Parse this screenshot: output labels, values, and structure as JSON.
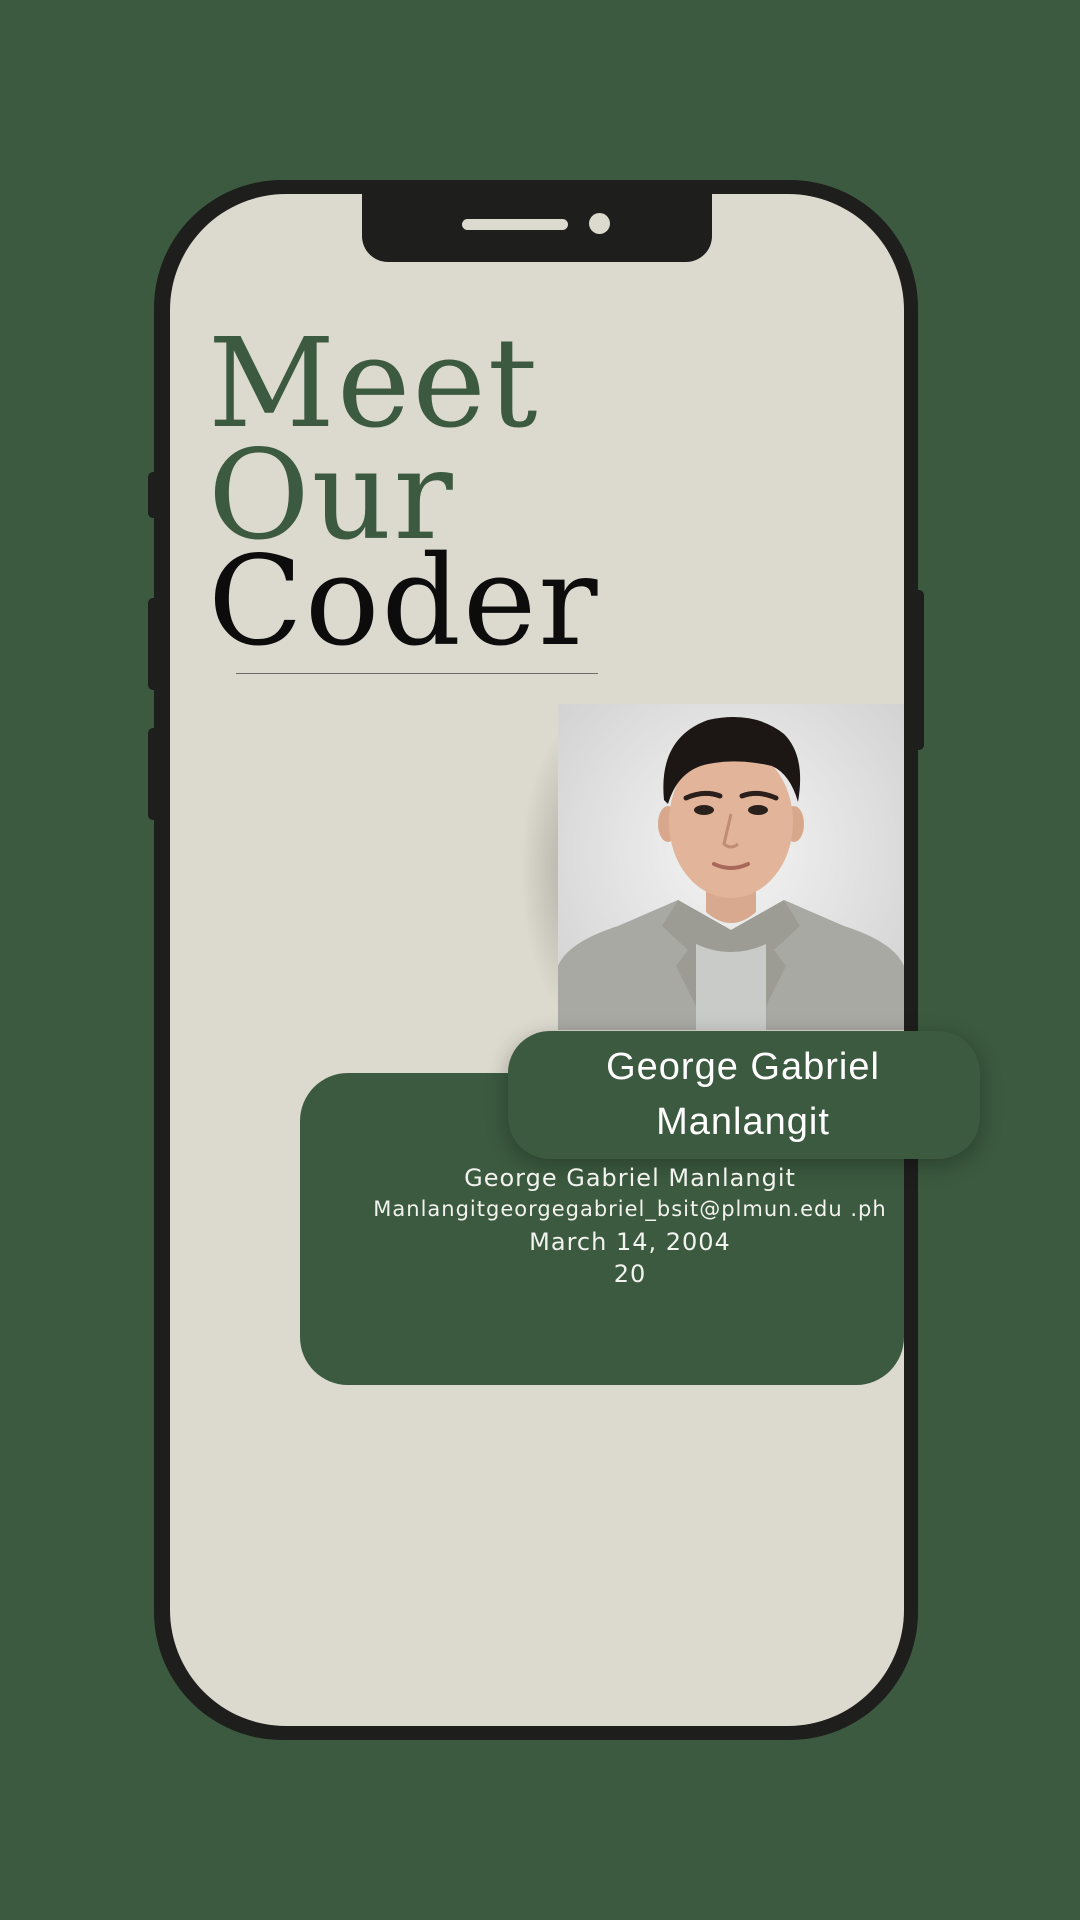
{
  "heading": {
    "line1": "Meet",
    "line2": "Our",
    "line3": "Coder"
  },
  "profile": {
    "tab_name": "George Gabriel Manlangit",
    "full_name": "George Gabriel Manlangit",
    "email": "Manlangitgeorgegabriel_bsit@plmun.edu .ph",
    "birthdate": "March 14, 2004",
    "age": "20"
  },
  "colors": {
    "background": "#3b5a3f",
    "screen": "#dcd9ce",
    "phone_frame": "#1e1e1c",
    "accent_green": "#3b5a3f",
    "text_dark": "#0c0c0c"
  },
  "icons": {
    "portrait": "person-photo"
  }
}
